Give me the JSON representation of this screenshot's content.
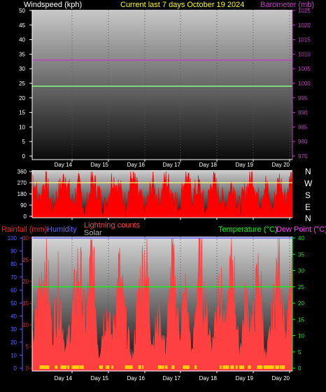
{
  "header": {
    "left_label": "Windspeed (kph)",
    "center_label": "Current last 7 days October 19 2024",
    "right_label": "Barometer (mb)"
  },
  "wind_dir_labels": [
    "N",
    "W",
    "S",
    "E",
    "N"
  ],
  "bottom_header": {
    "rainfall_label": "Rainfall (mm)",
    "humidity_label": "Humidity",
    "lightning_label": "Lightning counts",
    "solar_label": "Solar",
    "temperature_label": "Temperature (°C)",
    "dewpoint_label": "Dew Point (°C)"
  },
  "colors": {
    "windspeed": "#80ff80",
    "barometer": "#c040c0",
    "title": "#ffff00",
    "direction": "#ff0000",
    "rainfall": "#ff2020",
    "humidity": "#6060ff",
    "lightning": "#ff4040",
    "solar": "#b0b0b0",
    "temperature": "#00ff00",
    "dewpoint": "#ff40ff",
    "axis_white": "#ffffff"
  },
  "chart_data": [
    {
      "type": "line",
      "name": "wind-barometer",
      "x_categories": [
        "Day 14",
        "Day 15",
        "Day 16",
        "Day 17",
        "Day 18",
        "Day 19",
        "Day 20"
      ],
      "y_left": {
        "label": "Windspeed (kph)",
        "range": [
          0,
          50
        ],
        "ticks": [
          0,
          5,
          10,
          15,
          20,
          25,
          30,
          35,
          40,
          45,
          50
        ]
      },
      "y_right": {
        "label": "Barometer (mb)",
        "range": [
          975,
          1025
        ],
        "ticks": [
          975,
          980,
          985,
          990,
          995,
          1000,
          1005,
          1010,
          1015,
          1020,
          1025
        ]
      },
      "series": [
        {
          "name": "Windspeed (kph)",
          "axis": "left",
          "constant": 24
        },
        {
          "name": "Barometer (mb)",
          "axis": "right",
          "constant": 1008
        }
      ],
      "grid": true
    },
    {
      "type": "area",
      "name": "wind-direction",
      "x_categories": [
        "Day 14",
        "Day 15",
        "Day 16",
        "Day 17",
        "Day 18",
        "Day 19",
        "Day 20"
      ],
      "y_left": {
        "range": [
          0,
          360
        ],
        "ticks": [
          0,
          90,
          180,
          270,
          360
        ]
      },
      "reference_line": 270,
      "direction_profile": [
        340,
        120,
        300,
        60,
        200,
        330,
        100,
        250,
        20,
        300,
        180,
        60,
        310,
        230,
        90,
        330,
        160,
        40,
        280,
        120,
        300,
        200,
        70,
        340,
        150,
        250,
        30,
        310,
        170,
        90,
        280,
        60,
        200,
        330,
        110,
        260,
        40,
        300,
        150,
        350
      ]
    },
    {
      "type": "area",
      "name": "rain-temp",
      "x_categories": [
        "Day 14",
        "Day 15",
        "Day 16",
        "Day 17",
        "Day 18",
        "Day 19",
        "Day 20"
      ],
      "y_left_outer": {
        "label": "Humidity",
        "range": [
          0,
          100
        ],
        "ticks": [
          0,
          10,
          20,
          30,
          40,
          50,
          60,
          70,
          80,
          90,
          100
        ]
      },
      "y_left_inner": {
        "label": "Rainfall (mm)",
        "range": [
          0,
          30
        ],
        "ticks": [
          0,
          5,
          10,
          15,
          20,
          25,
          30
        ]
      },
      "y_right": {
        "label": "Temperature (°C)",
        "range": [
          0,
          40
        ],
        "ticks": [
          0,
          5,
          10,
          15,
          20,
          25,
          30,
          35,
          40
        ]
      },
      "series": [
        {
          "name": "Humidity",
          "axis": "left_outer",
          "constant": 100
        },
        {
          "name": "Temperature (°C)",
          "axis": "right",
          "constant": 25
        },
        {
          "name": "Lightning counts",
          "profile": [
            6,
            18,
            30,
            9,
            22,
            4,
            14,
            27,
            11,
            30,
            3,
            16,
            8,
            25,
            12,
            2,
            20,
            30,
            7,
            13,
            5,
            28,
            10,
            19,
            3,
            30,
            15,
            6,
            24,
            9,
            30,
            4,
            17,
            11,
            26,
            2,
            13,
            30,
            8,
            21
          ]
        }
      ],
      "grid": true
    }
  ]
}
